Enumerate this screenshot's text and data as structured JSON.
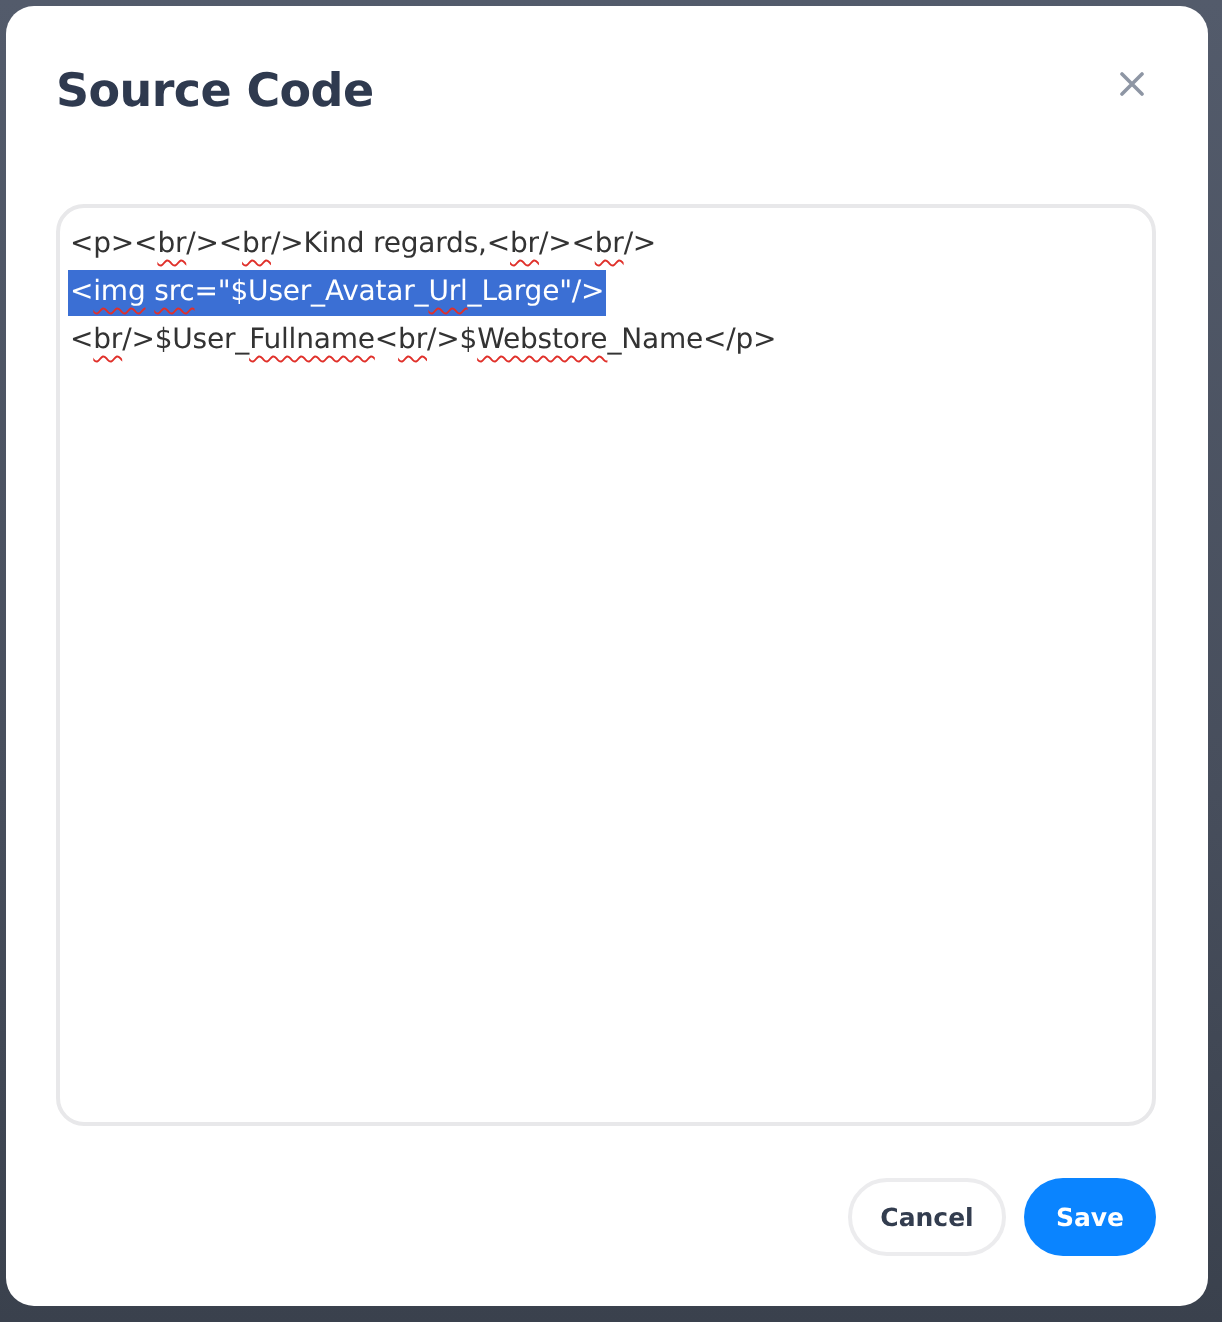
{
  "dialog": {
    "title": "Source Code"
  },
  "editor": {
    "lines": [
      {
        "selected": false,
        "segments": [
          {
            "text": "<p><",
            "spell_error": false
          },
          {
            "text": "br",
            "spell_error": true
          },
          {
            "text": "/><",
            "spell_error": false
          },
          {
            "text": "br",
            "spell_error": true
          },
          {
            "text": "/>Kind regards,<",
            "spell_error": false
          },
          {
            "text": "br",
            "spell_error": true
          },
          {
            "text": "/><",
            "spell_error": false
          },
          {
            "text": "br",
            "spell_error": true
          },
          {
            "text": "/>",
            "spell_error": false
          }
        ]
      },
      {
        "selected": true,
        "segments": [
          {
            "text": "<",
            "spell_error": false
          },
          {
            "text": "img",
            "spell_error": true
          },
          {
            "text": " src",
            "spell_error": true
          },
          {
            "text": "=\"$User_Avatar_",
            "spell_error": false
          },
          {
            "text": "Url",
            "spell_error": true
          },
          {
            "text": "_Large\"/>",
            "spell_error": false
          }
        ]
      },
      {
        "selected": false,
        "segments": [
          {
            "text": "<",
            "spell_error": false
          },
          {
            "text": "br",
            "spell_error": true
          },
          {
            "text": "/>$User_",
            "spell_error": false
          },
          {
            "text": "Fullname",
            "spell_error": true
          },
          {
            "text": "<",
            "spell_error": false
          },
          {
            "text": "br",
            "spell_error": true
          },
          {
            "text": "/>$",
            "spell_error": false
          },
          {
            "text": "Webstore",
            "spell_error": true
          },
          {
            "text": "_Name</p>",
            "spell_error": false
          }
        ]
      }
    ]
  },
  "buttons": [
    {
      "label": "Cancel",
      "kind": "secondary"
    },
    {
      "label": "Save",
      "kind": "primary"
    }
  ]
}
